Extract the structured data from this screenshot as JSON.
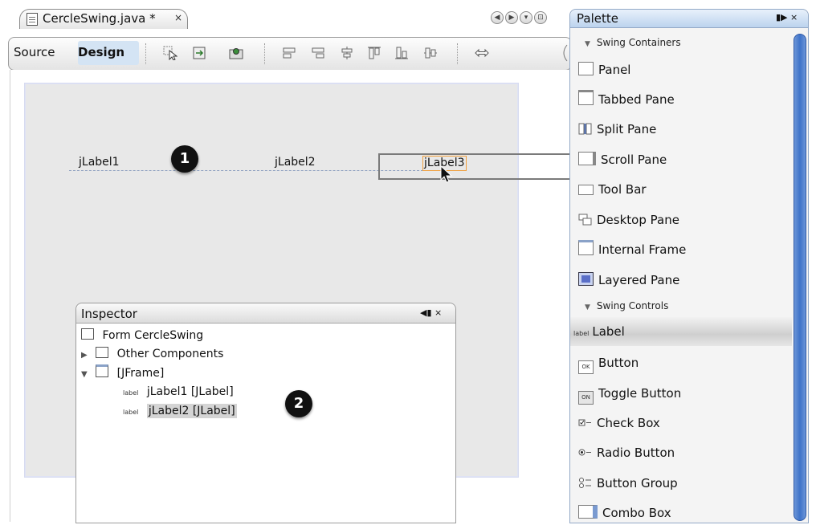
{
  "editor": {
    "tab_title": "CercleSwing.java *",
    "tab_close": "×",
    "nav_buttons": [
      "◀",
      "▶",
      "▾",
      "⊡"
    ],
    "toolbar": {
      "source_label": "Source",
      "design_label": "Design",
      "icons": [
        "selection-mode-icon",
        "connection-mode-icon",
        "preview-design-icon",
        "align-left-icon",
        "align-right-icon",
        "center-horizontally-icon",
        "align-top-icon",
        "align-bottom-icon",
        "center-vertically-icon",
        "change-horizontal-resizability-icon"
      ]
    }
  },
  "form": {
    "labels": [
      "jLabel1",
      "jLabel2",
      "jLabel3"
    ],
    "callouts": [
      "1",
      "2"
    ]
  },
  "inspector": {
    "title": "Inspector",
    "controls": "◀▮ ×",
    "tree": [
      {
        "label": "Form CercleSwing"
      },
      {
        "label": "Other Components",
        "toggle": "▶"
      },
      {
        "label": "[JFrame]",
        "toggle": "▼"
      },
      {
        "label": "jLabel1 [JLabel]",
        "badge": "label"
      },
      {
        "label": "jLabel2 [JLabel]",
        "badge": "label"
      }
    ]
  },
  "palette": {
    "title": "Palette",
    "controls": "▮▶ ×",
    "categories": [
      "Swing Containers",
      "Swing Controls"
    ],
    "containers": [
      "Panel",
      "Tabbed Pane",
      "Split Pane",
      "Scroll Pane",
      "Tool Bar",
      "Desktop Pane",
      "Internal Frame",
      "Layered Pane"
    ],
    "controls_items": [
      "Label",
      "Button",
      "Toggle Button",
      "Check Box",
      "Radio Button",
      "Button Group",
      "Combo Box"
    ],
    "control_badges": [
      "label",
      "OK",
      "ON",
      "",
      "",
      "",
      ""
    ]
  }
}
